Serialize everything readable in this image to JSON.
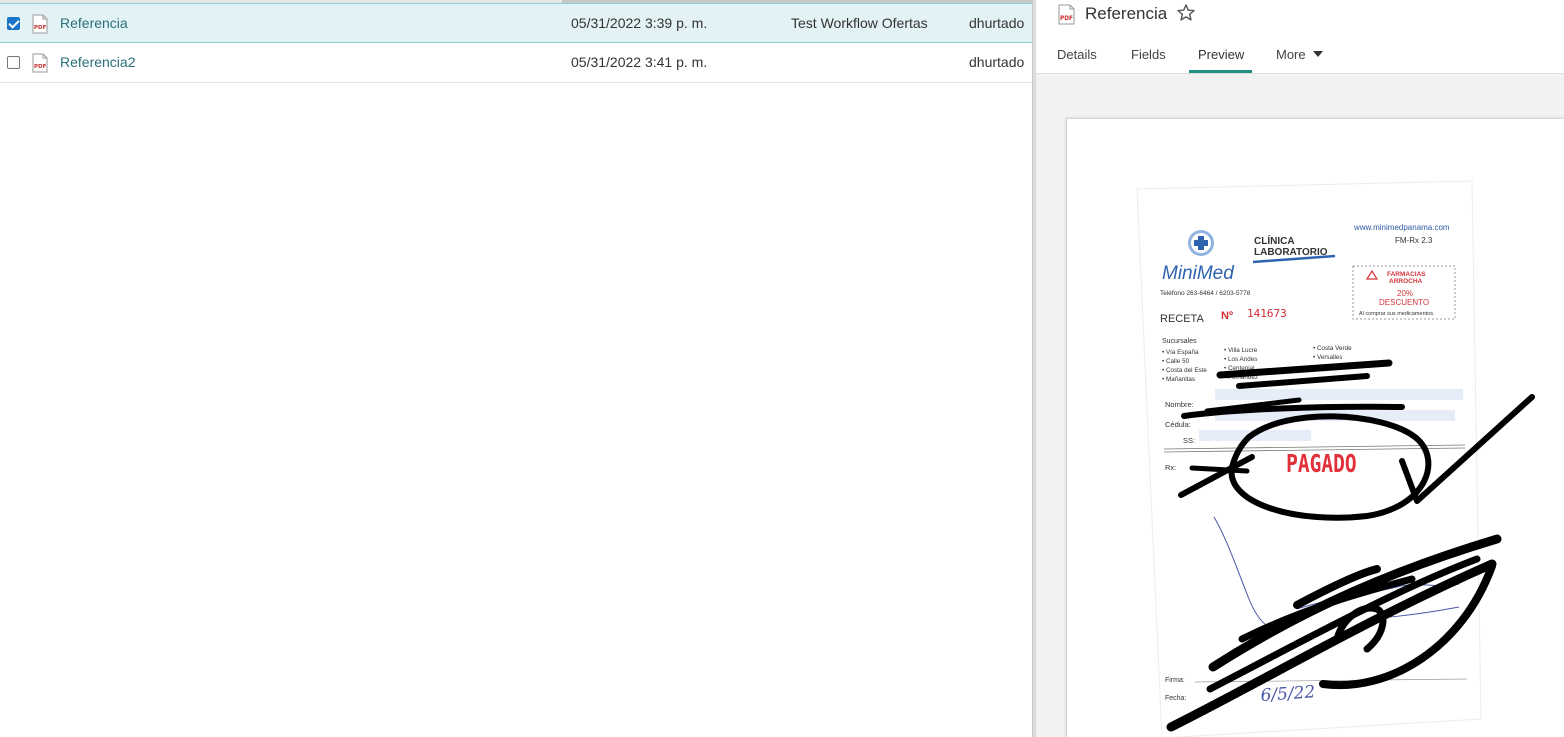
{
  "list": {
    "rows": [
      {
        "checked": true,
        "file_type": "PDF",
        "name": "Referencia",
        "date": "05/31/2022 3:39 p. m.",
        "workflow": "Test Workflow Ofertas",
        "user": "dhurtado"
      },
      {
        "checked": false,
        "file_type": "PDF",
        "name": "Referencia2",
        "date": "05/31/2022 3:41 p. m.",
        "workflow": "",
        "user": "dhurtado"
      }
    ]
  },
  "preview": {
    "file_type": "PDF",
    "title": "Referencia",
    "favorite_icon": "star-outline-icon",
    "tabs": [
      {
        "label": "Details"
      },
      {
        "label": "Fields"
      },
      {
        "label": "Preview",
        "active": true
      },
      {
        "label": "More"
      }
    ],
    "document": {
      "logo_text": "MiniMed",
      "clinic_line1": "CLÍNICA",
      "clinic_line2": "LABORATORIO",
      "website": "www.minimedpanama.com",
      "form_code": "FM-Rx 2.3",
      "phone": "Teléfono 263-6464 / 6203-5778",
      "receta_label": "RECETA",
      "receta_no_label": "Nº",
      "receta_number": "141673",
      "promo": {
        "line1": "FARMACIAS",
        "line2": "ARROCHA",
        "line3": "20%",
        "line4": "DESCUENTO",
        "line5": "Al comprar sus medicamentos."
      },
      "sucursales_label": "Sucursales",
      "branches_col1": [
        "Vía España",
        "Calle 50",
        "Costa del Este",
        "Mañanitas"
      ],
      "branches_col2": [
        "Villa Lucre",
        "Los Andes",
        "Centenial",
        "Fernández"
      ],
      "branches_col3": [
        "Costa Verde",
        "Versalles"
      ],
      "nombre_label": "Nombre:",
      "cedula_label": "Cédula:",
      "ss_label": "SS:",
      "rx_label": "Rx:",
      "stamp": "PAGADO",
      "firma_label": "Firma:",
      "fecha_label": "Fecha:",
      "handwritten_date": "6/5/22"
    }
  },
  "colors": {
    "selected_row_bg": "#e3f2f4",
    "link_teal": "#2a6f7c",
    "tab_active": "#1f8f82",
    "checkbox_blue": "#1a73c9",
    "stamp_red": "#e2303a",
    "logo_blue": "#2e63b0"
  }
}
